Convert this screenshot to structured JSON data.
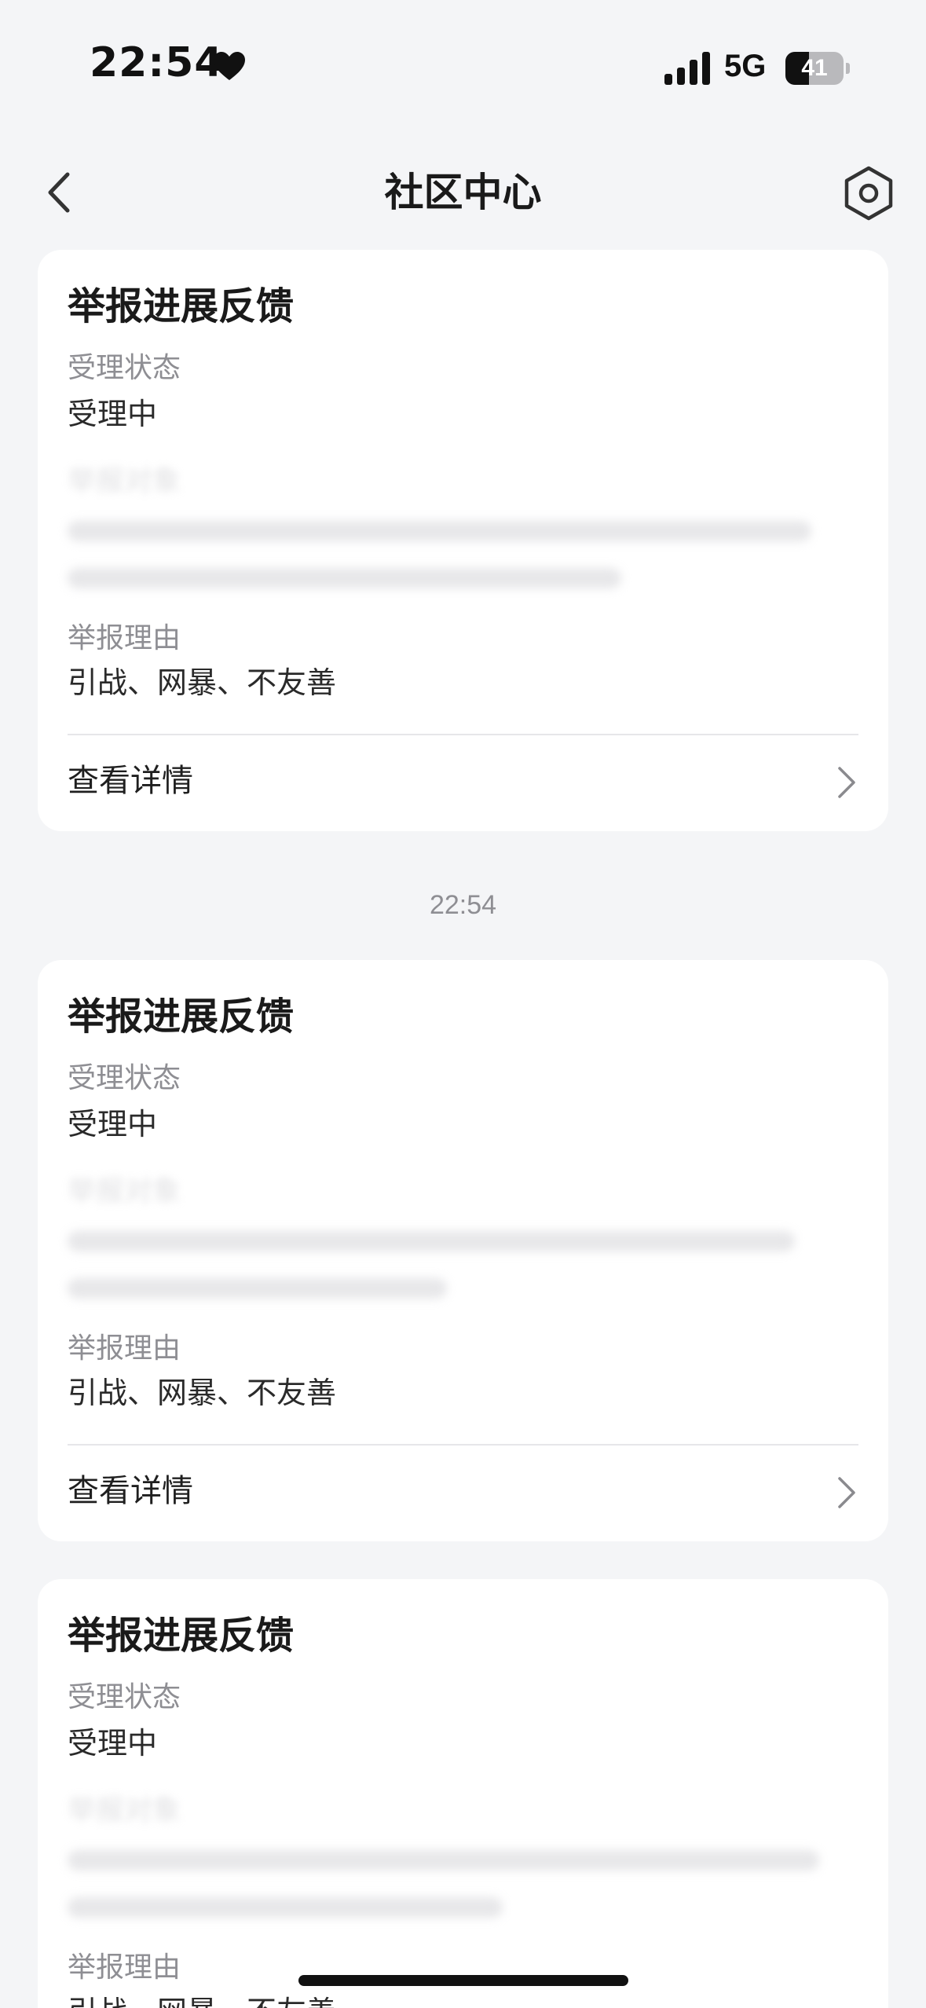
{
  "status_bar": {
    "time": "22:54",
    "network": "5G",
    "battery_level": "41",
    "battery_percent": 41,
    "icons": [
      "heart-icon",
      "signal-icon",
      "battery-icon"
    ]
  },
  "nav": {
    "title": "社区中心",
    "back_icon": "chevron-left-icon",
    "settings_icon": "settings-icon"
  },
  "feed": {
    "timestamp": "22:54",
    "cards": [
      {
        "title": "举报进展反馈",
        "status_label": "受理状态",
        "status_value": "受理中",
        "target_label": "举报对象",
        "reason_label": "举报理由",
        "reason_value": "引战、网暴、不友善",
        "detail_label": "查看详情"
      },
      {
        "title": "举报进展反馈",
        "status_label": "受理状态",
        "status_value": "受理中",
        "target_label": "举报对象",
        "reason_label": "举报理由",
        "reason_value": "引战、网暴、不友善",
        "detail_label": "查看详情"
      },
      {
        "title": "举报进展反馈",
        "status_label": "受理状态",
        "status_value": "受理中",
        "target_label": "举报对象",
        "reason_label": "举报理由",
        "reason_value": "引战、网暴、不友善"
      }
    ]
  },
  "colors": {
    "background": "#f4f5f7",
    "card": "#ffffff",
    "muted_text": "#8e8e93",
    "primary_text": "#1a1a1a"
  }
}
